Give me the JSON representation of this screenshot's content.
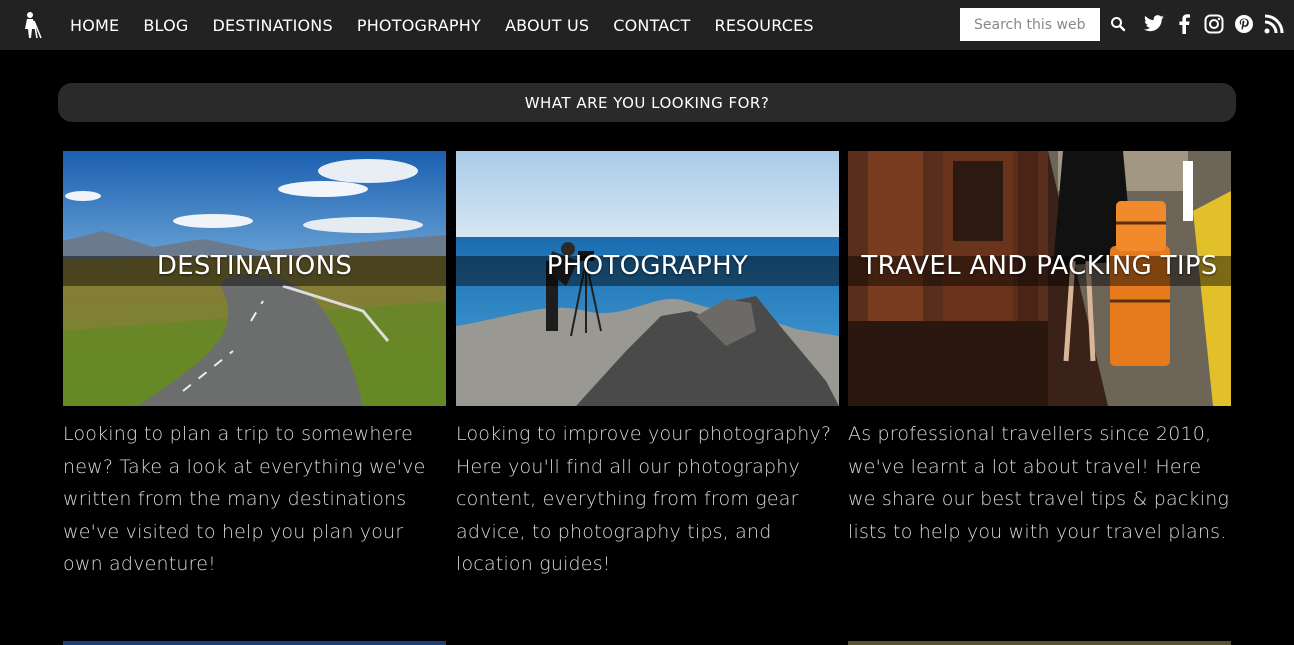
{
  "nav": {
    "items": [
      "HOME",
      "BLOG",
      "DESTINATIONS",
      "PHOTOGRAPHY",
      "ABOUT US",
      "CONTACT",
      "RESOURCES"
    ],
    "search_placeholder": "Search this web"
  },
  "social_icons": [
    "search-icon",
    "twitter-icon",
    "facebook-icon",
    "instagram-icon",
    "pinterest-icon",
    "rss-icon"
  ],
  "banner": {
    "label": "WHAT ARE YOU LOOKING FOR?"
  },
  "cards": [
    {
      "title": "DESTINATIONS",
      "description": "Looking to plan a trip to somewhere new? Take a look at everything we've written from the many destinations we've visited to help you plan your own adventure!"
    },
    {
      "title": "PHOTOGRAPHY",
      "description": "Looking to improve your photography? Here you'll find all our photography content, everything from from gear advice, to photography tips, and location guides!"
    },
    {
      "title": "TRAVEL AND PACKING TIPS",
      "description": "As professional travellers since 2010, we've learnt a lot about travel! Here we share our best travel tips & packing lists to help you with your travel plans."
    }
  ]
}
